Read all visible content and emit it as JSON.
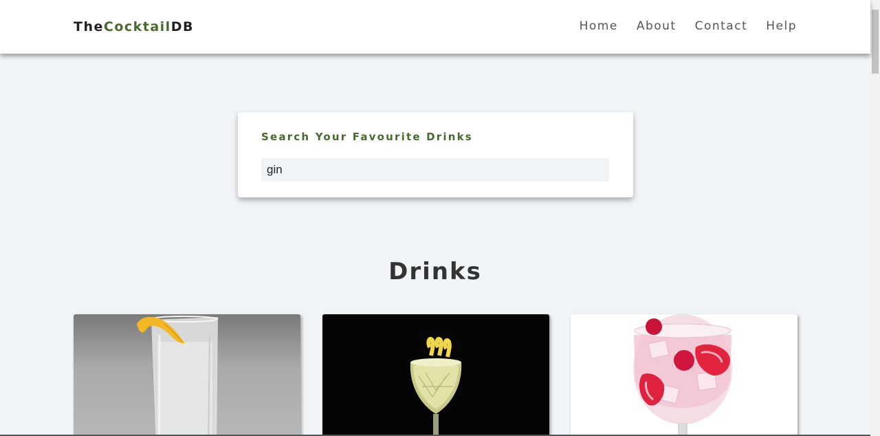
{
  "navbar": {
    "logo": {
      "part1": "The",
      "part2": "Cocktail",
      "part3": "DB"
    },
    "links": [
      "Home",
      "About",
      "Contact",
      "Help"
    ]
  },
  "search": {
    "label": "Search Your Favourite Drinks",
    "value": "gin"
  },
  "section": {
    "title": "Drinks"
  },
  "colors": {
    "accent": "#476a2e",
    "background": "#f1f4f7",
    "text_dark": "#333333"
  },
  "drinks": [
    {
      "image": "tall-glass-lemon-twist-icon"
    },
    {
      "image": "crystal-glass-lemon-peel-icon"
    },
    {
      "image": "pink-gin-strawberries-icon"
    }
  ]
}
